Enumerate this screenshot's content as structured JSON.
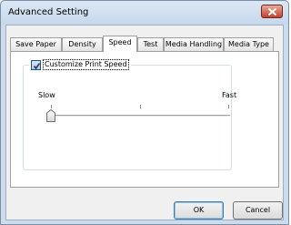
{
  "window": {
    "title": "Advanced Setting",
    "close_icon": "close-icon",
    "accent_color": "#c7402a"
  },
  "tabs": [
    {
      "label": "Save Paper",
      "active": false
    },
    {
      "label": "Density",
      "active": false
    },
    {
      "label": "Speed",
      "active": true
    },
    {
      "label": "Test",
      "active": false
    },
    {
      "label": "Media Handling",
      "active": false
    },
    {
      "label": "Media Type",
      "active": false
    }
  ],
  "speed_panel": {
    "checkbox_label": "Customize Print Speed",
    "checked": true,
    "slider_min_label": "Slow",
    "slider_max_label": "Fast",
    "slider_value_fraction": 0.0
  },
  "buttons": {
    "ok": "OK",
    "cancel": "Cancel"
  }
}
